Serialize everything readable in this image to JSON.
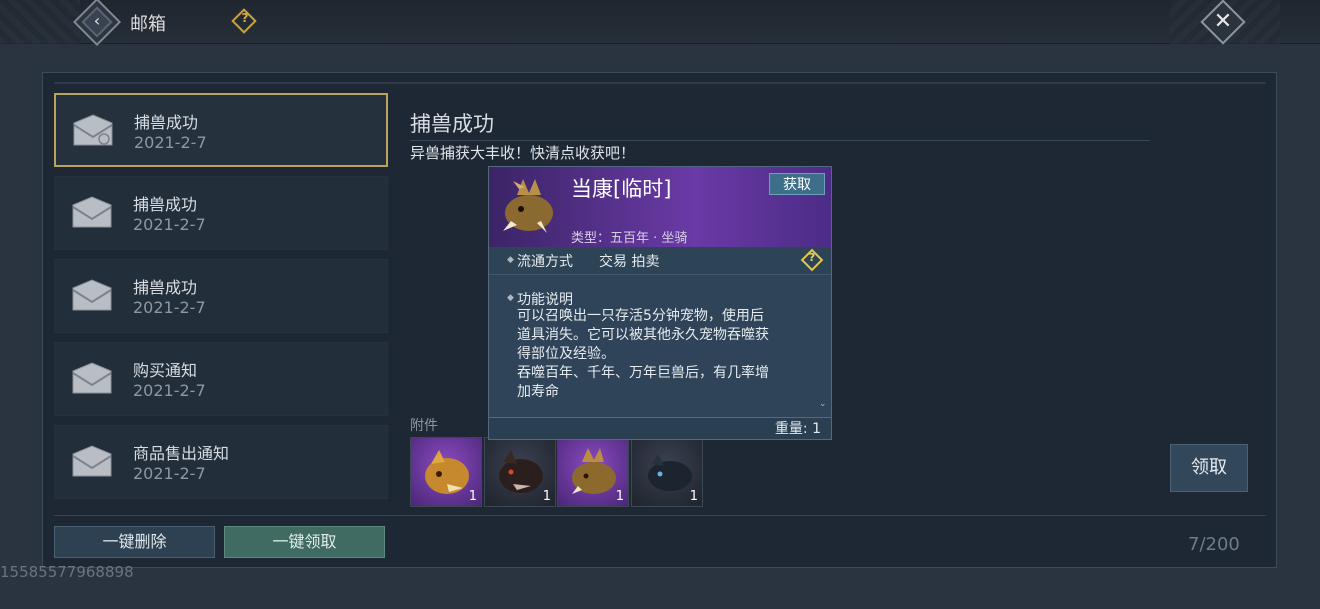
{
  "header": {
    "title": "邮箱",
    "help_glyph": "?",
    "back_icon": "back-arrow-icon",
    "close_icon": "close-icon"
  },
  "mail_list": [
    {
      "title": "捕兽成功",
      "date": "2021-2-7",
      "selected": true
    },
    {
      "title": "捕兽成功",
      "date": "2021-2-7",
      "selected": false
    },
    {
      "title": "捕兽成功",
      "date": "2021-2-7",
      "selected": false
    },
    {
      "title": "购买通知",
      "date": "2021-2-7",
      "selected": false
    },
    {
      "title": "商品售出通知",
      "date": "2021-2-7",
      "selected": false
    }
  ],
  "content": {
    "title": "捕兽成功",
    "body": "异兽捕获大丰收！快清点收获吧！",
    "attachments_label": "附件",
    "attachments": [
      {
        "icon": "purple-beast-icon",
        "qty": "1",
        "rarity": "purple"
      },
      {
        "icon": "dark-wolf-icon",
        "qty": "1",
        "rarity": "dark"
      },
      {
        "icon": "purple-boar-icon",
        "qty": "1",
        "rarity": "purple"
      },
      {
        "icon": "dark-panther-icon",
        "qty": "1",
        "rarity": "dark"
      }
    ],
    "claim_label": "领取"
  },
  "tooltip": {
    "name": "当康[临时]",
    "get_label": "获取",
    "type": "类型：五百年 · 坐骑",
    "circulation_label": "流通方式",
    "circulation_value": "交易 拍卖",
    "help_glyph": "?",
    "function_label": "功能说明",
    "description_lines": [
      "可以召唤出一只存活5分钟宠物，使用后",
      "道具消失。它可以被其他永久宠物吞噬获",
      "得部位及经验。",
      "吞噬百年、千年、万年巨兽后，有几率增",
      "加寿命"
    ],
    "weight": "重量: 1"
  },
  "footer": {
    "delete_all": "一键删除",
    "claim_all": "一键领取",
    "count": "7/200"
  },
  "watermark": "15585577968898",
  "colors": {
    "selected_border": "#b8a55a",
    "purple_rarity": "#6a3aa6",
    "claim_all_bg": "#3f6b63"
  }
}
